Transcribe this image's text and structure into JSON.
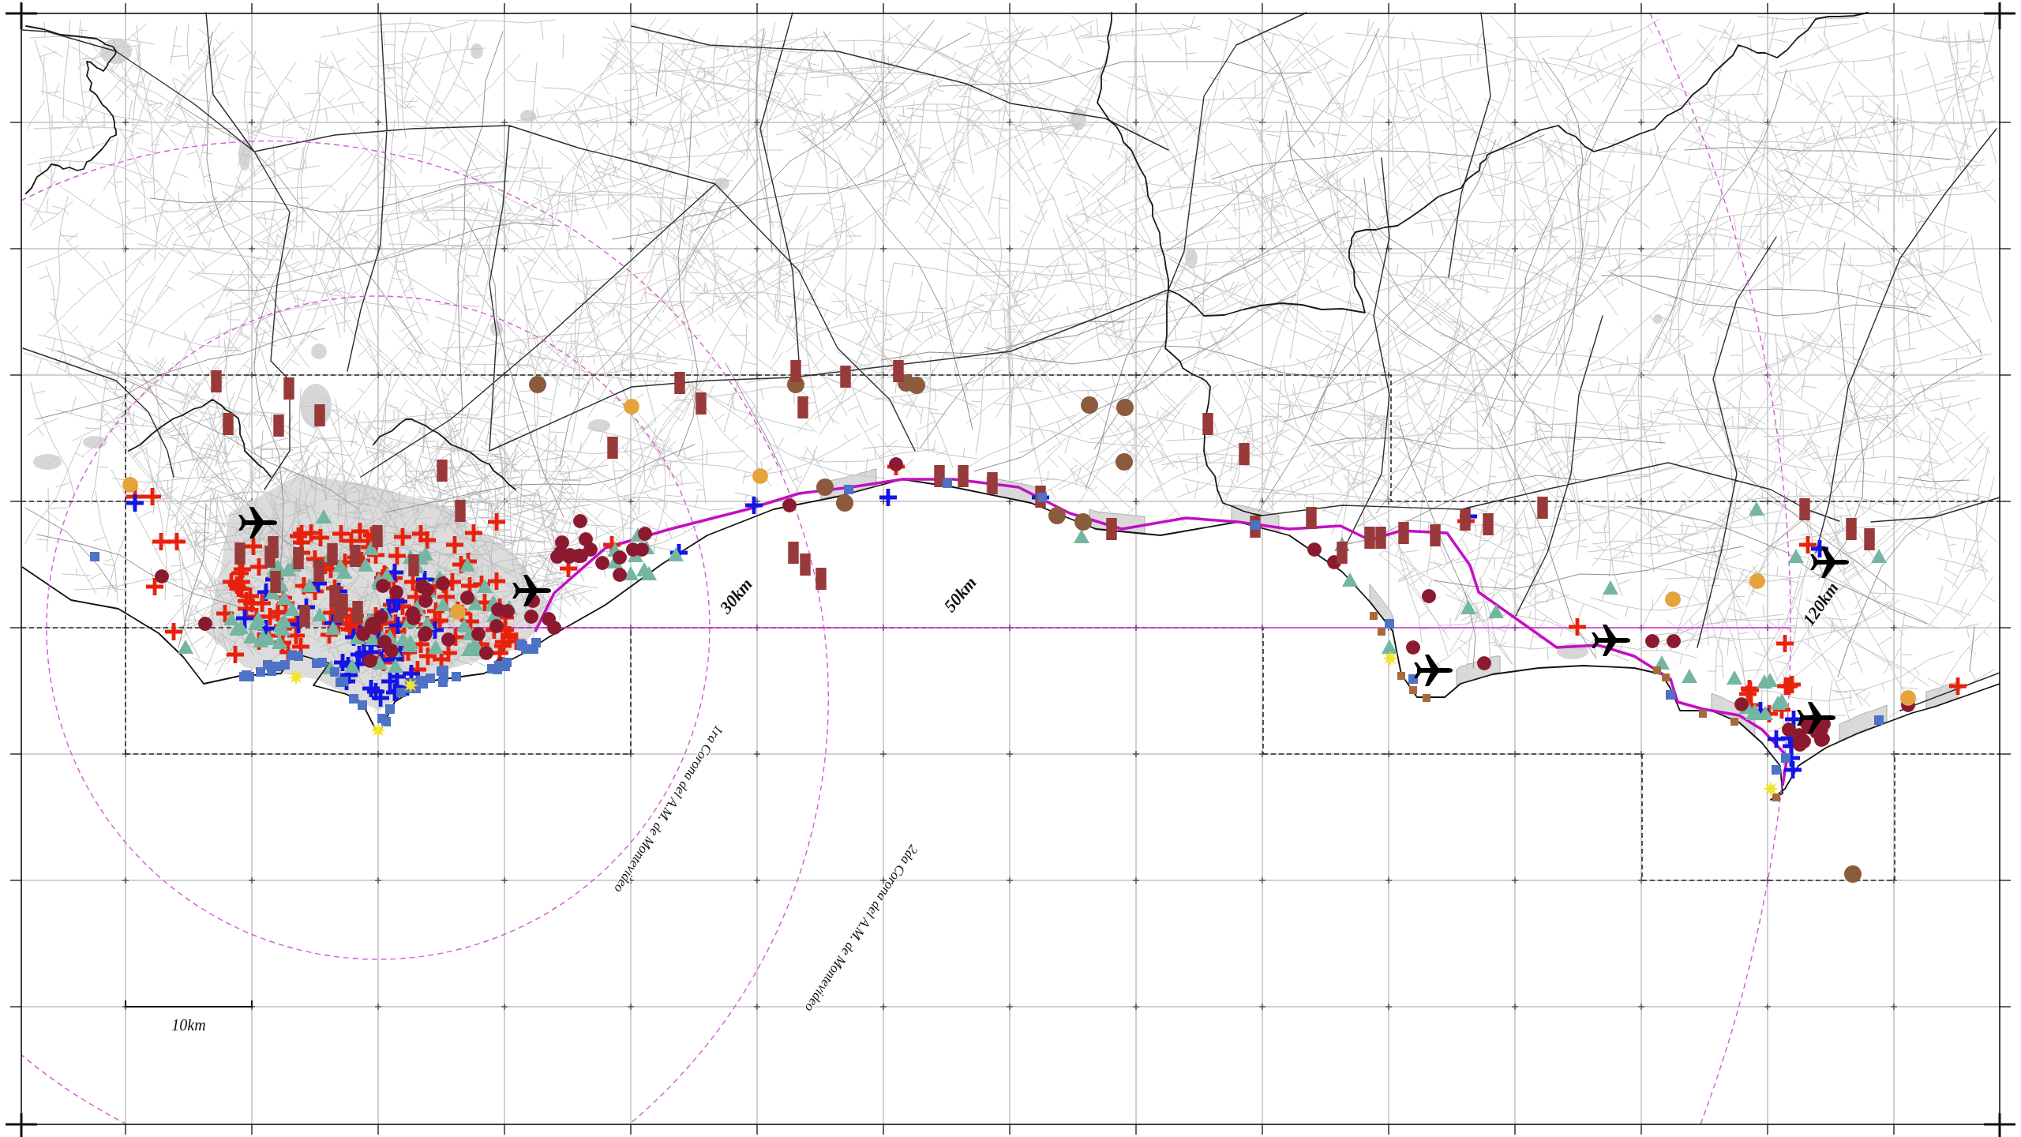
{
  "map": {
    "rings": [
      {
        "distance": "30km",
        "caption": "1ra Corona del A.M. de Montevideo"
      },
      {
        "distance": "50km",
        "caption": "2da Corona del A.M. de Montevideo"
      },
      {
        "distance": "120km"
      }
    ],
    "scale_bar": {
      "label": "10km"
    },
    "markers": [
      {
        "kind": "cross",
        "color": "#e8210c"
      },
      {
        "kind": "cross",
        "color": "#1414e6"
      },
      {
        "kind": "triangle",
        "color": "#74b6a2"
      },
      {
        "kind": "circle",
        "color": "#8b1a30"
      },
      {
        "kind": "circle",
        "color": "#8c5a3c"
      },
      {
        "kind": "circle",
        "color": "#e5a33b"
      },
      {
        "kind": "bar",
        "color": "#983a3a"
      },
      {
        "kind": "square",
        "color": "#4d72c6"
      },
      {
        "kind": "star",
        "color": "#f3e42c"
      },
      {
        "kind": "square",
        "color": "#a86a3a"
      }
    ]
  }
}
